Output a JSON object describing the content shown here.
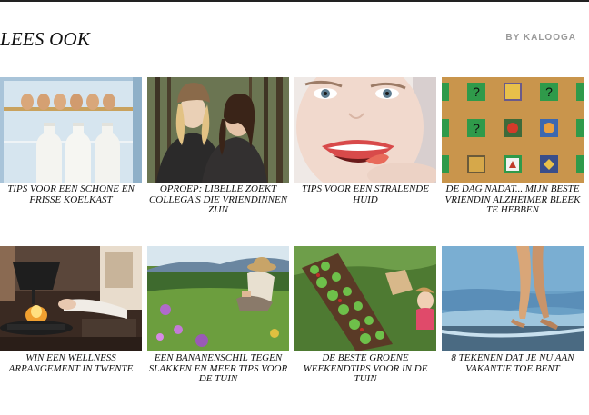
{
  "header": {
    "title": "LEES OOK",
    "byline": "BY KALOOGA"
  },
  "articles": [
    {
      "caption": "TIPS VOOR EEN SCHONE EN FRISSE KOELKAST"
    },
    {
      "caption": "OPROEP: LIBELLE ZOEKT COLLEGA'S DIE VRIENDINNEN ZIJN"
    },
    {
      "caption": "TIPS VOOR EEN STRALENDE HUID"
    },
    {
      "caption": "DE DAG NADAT... MIJN BESTE VRIENDIN ALZHEIMER BLEEK TE HEBBEN"
    },
    {
      "caption": "WIN EEN WELLNESS ARRANGEMENT IN TWENTE"
    },
    {
      "caption": "EEN BANANENSCHIL TEGEN SLAKKEN EN MEER TIPS VOOR DE TUIN"
    },
    {
      "caption": "DE BESTE GROENE WEEKENDTIPS VOOR IN DE TUIN"
    },
    {
      "caption": "8 TEKENEN DAT JE NU AAN VAKANTIE TOE BENT"
    }
  ]
}
